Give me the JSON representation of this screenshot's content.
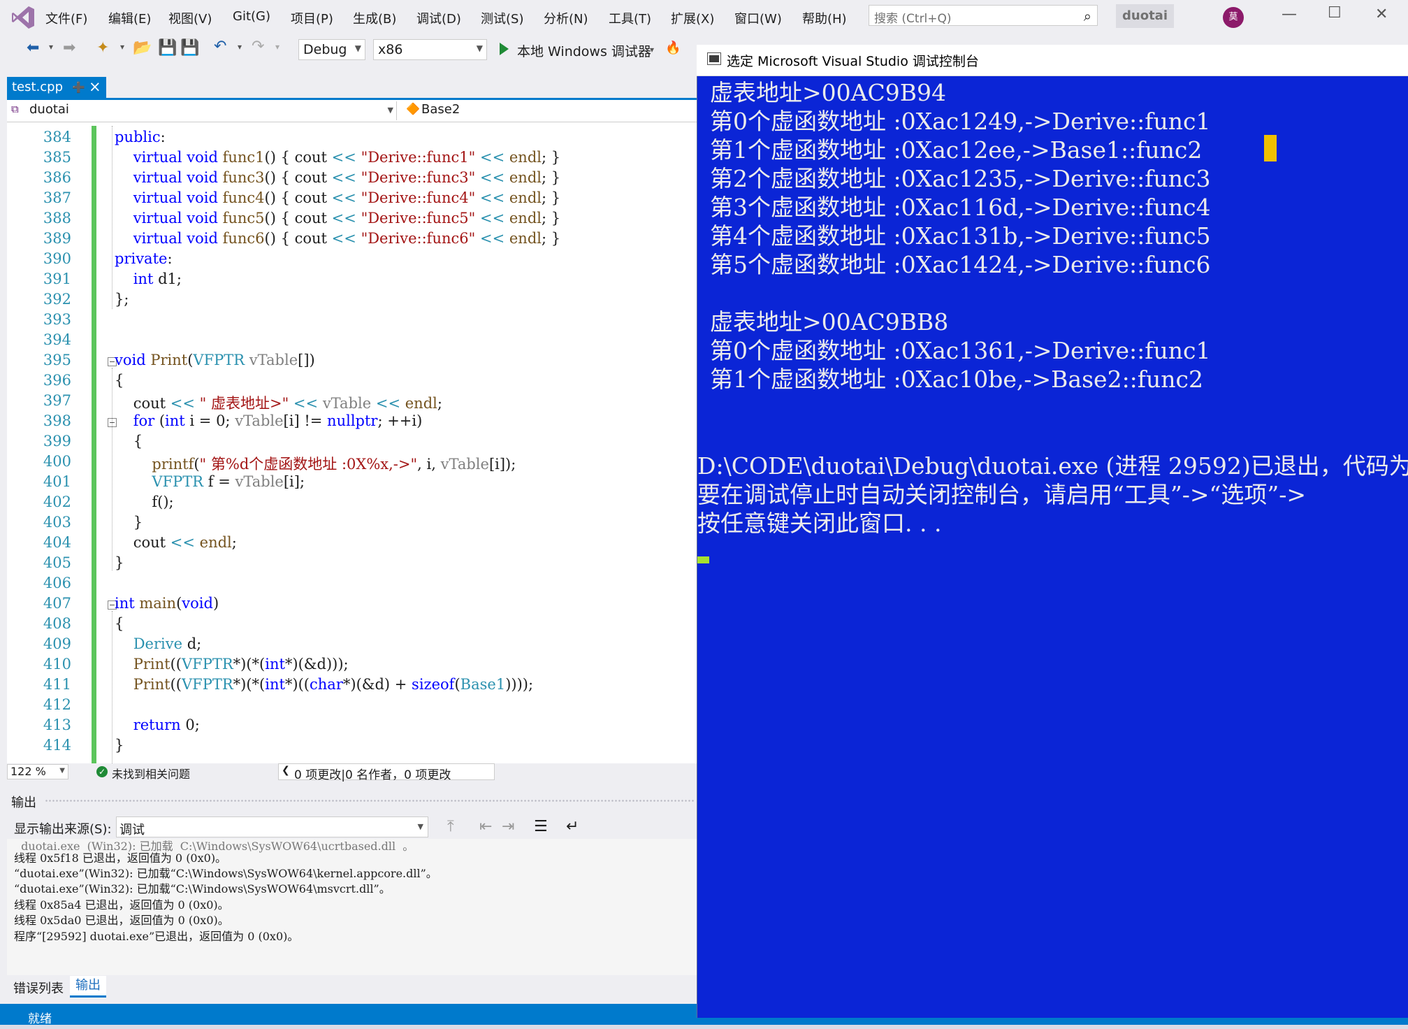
{
  "menubar": {
    "items": [
      "文件(F)",
      "编辑(E)",
      "视图(V)",
      "Git(G)",
      "项目(P)",
      "生成(B)",
      "调试(D)",
      "测试(S)",
      "分析(N)",
      "工具(T)",
      "扩展(X)",
      "窗口(W)",
      "帮助(H)"
    ],
    "search_placeholder": "搜索 (Ctrl+Q)",
    "solution_name": "duotai",
    "avatar_initial": "莫"
  },
  "toolbar": {
    "config": "Debug",
    "platform": "x86",
    "run_label": "本地 Windows 调试器"
  },
  "editor": {
    "tab_name": "test.cpp",
    "nav_scope": "duotai",
    "nav_member": "Base2",
    "line_numbers": [
      "384",
      "385",
      "386",
      "387",
      "388",
      "389",
      "390",
      "391",
      "392",
      "393",
      "394",
      "395",
      "396",
      "397",
      "398",
      "399",
      "400",
      "401",
      "402",
      "403",
      "404",
      "405",
      "406",
      "407",
      "408",
      "409",
      "410",
      "411",
      "412",
      "413",
      "414"
    ],
    "lines": [
      "public:",
      "    virtual void func1() { cout << \"Derive::func1\" << endl; }",
      "    virtual void func3() { cout << \"Derive::func3\" << endl; }",
      "    virtual void func4() { cout << \"Derive::func4\" << endl; }",
      "    virtual void func5() { cout << \"Derive::func5\" << endl; }",
      "    virtual void func6() { cout << \"Derive::func6\" << endl; }",
      "private:",
      "    int d1;",
      "};",
      "",
      "",
      "void Print(VFPTR vTable[])",
      "{",
      "    cout << \" 虚表地址>\" << vTable << endl;",
      "    for (int i = 0; vTable[i] != nullptr; ++i)",
      "    {",
      "        printf(\" 第%d个虚函数地址 :0X%x,->\", i, vTable[i]);",
      "        VFPTR f = vTable[i];",
      "        f();",
      "    }",
      "    cout << endl;",
      "}",
      "",
      "int main(void)",
      "{",
      "    Derive d;",
      "    Print((VFPTR*)(*(int*)(&d)));",
      "    Print((VFPTR*)(*(int*)((char*)(&d) + sizeof(Base1))));",
      "",
      "    return 0;",
      "}"
    ],
    "zoom": "122 %",
    "issues": "未找到相关问题",
    "changes": "0 项更改|0 名作者，0 项更改"
  },
  "output": {
    "title": "输出",
    "source_label": "显示输出来源(S):",
    "source_value": "调试",
    "lines": [
      "  duotai.exe  (Win32): 已加载  C:\\Windows\\SysWOW64\\ucrtbased.dll  。",
      "线程 0x5f18 已退出，返回值为 0 (0x0)。",
      "“duotai.exe”(Win32): 已加载“C:\\Windows\\SysWOW64\\kernel.appcore.dll”。",
      "“duotai.exe”(Win32): 已加载“C:\\Windows\\SysWOW64\\msvcrt.dll”。",
      "线程 0x85a4 已退出，返回值为 0 (0x0)。",
      "线程 0x5da0 已退出，返回值为 0 (0x0)。",
      "程序“[29592] duotai.exe”已退出，返回值为 0 (0x0)。"
    ],
    "tab_errors": "错误列表",
    "tab_output": "输出",
    "status": "就绪"
  },
  "console": {
    "title": "选定 Microsoft Visual Studio 调试控制台",
    "block1": [
      "虚表地址>00AC9B94",
      "第0个虚函数地址 :0Xac1249,->Derive::func1",
      "第1个虚函数地址 :0Xac12ee,->Base1::func2",
      "第2个虚函数地址 :0Xac1235,->Derive::func3",
      "第3个虚函数地址 :0Xac116d,->Derive::func4",
      "第4个虚函数地址 :0Xac131b,->Derive::func5",
      "第5个虚函数地址 :0Xac1424,->Derive::func6"
    ],
    "block2": [
      "虚表地址>00AC9BB8",
      "第0个虚函数地址 :0Xac1361,->Derive::func1",
      "第1个虚函数地址 :0Xac10be,->Base2::func2"
    ],
    "exit_lines": [
      "D:\\CODE\\duotai\\Debug\\duotai.exe (进程 29592)已退出，代码为",
      "要在调试停止时自动关闭控制台，请启用“工具”->“选项”->",
      "按任意键关闭此窗口. . ."
    ]
  },
  "colors": {
    "accent": "#007acc",
    "console_bg": "#0b25d6",
    "console_text": "#ebebeb",
    "change_bar": "#5cc55c",
    "keyword": "#0000ff",
    "string": "#a31515"
  }
}
